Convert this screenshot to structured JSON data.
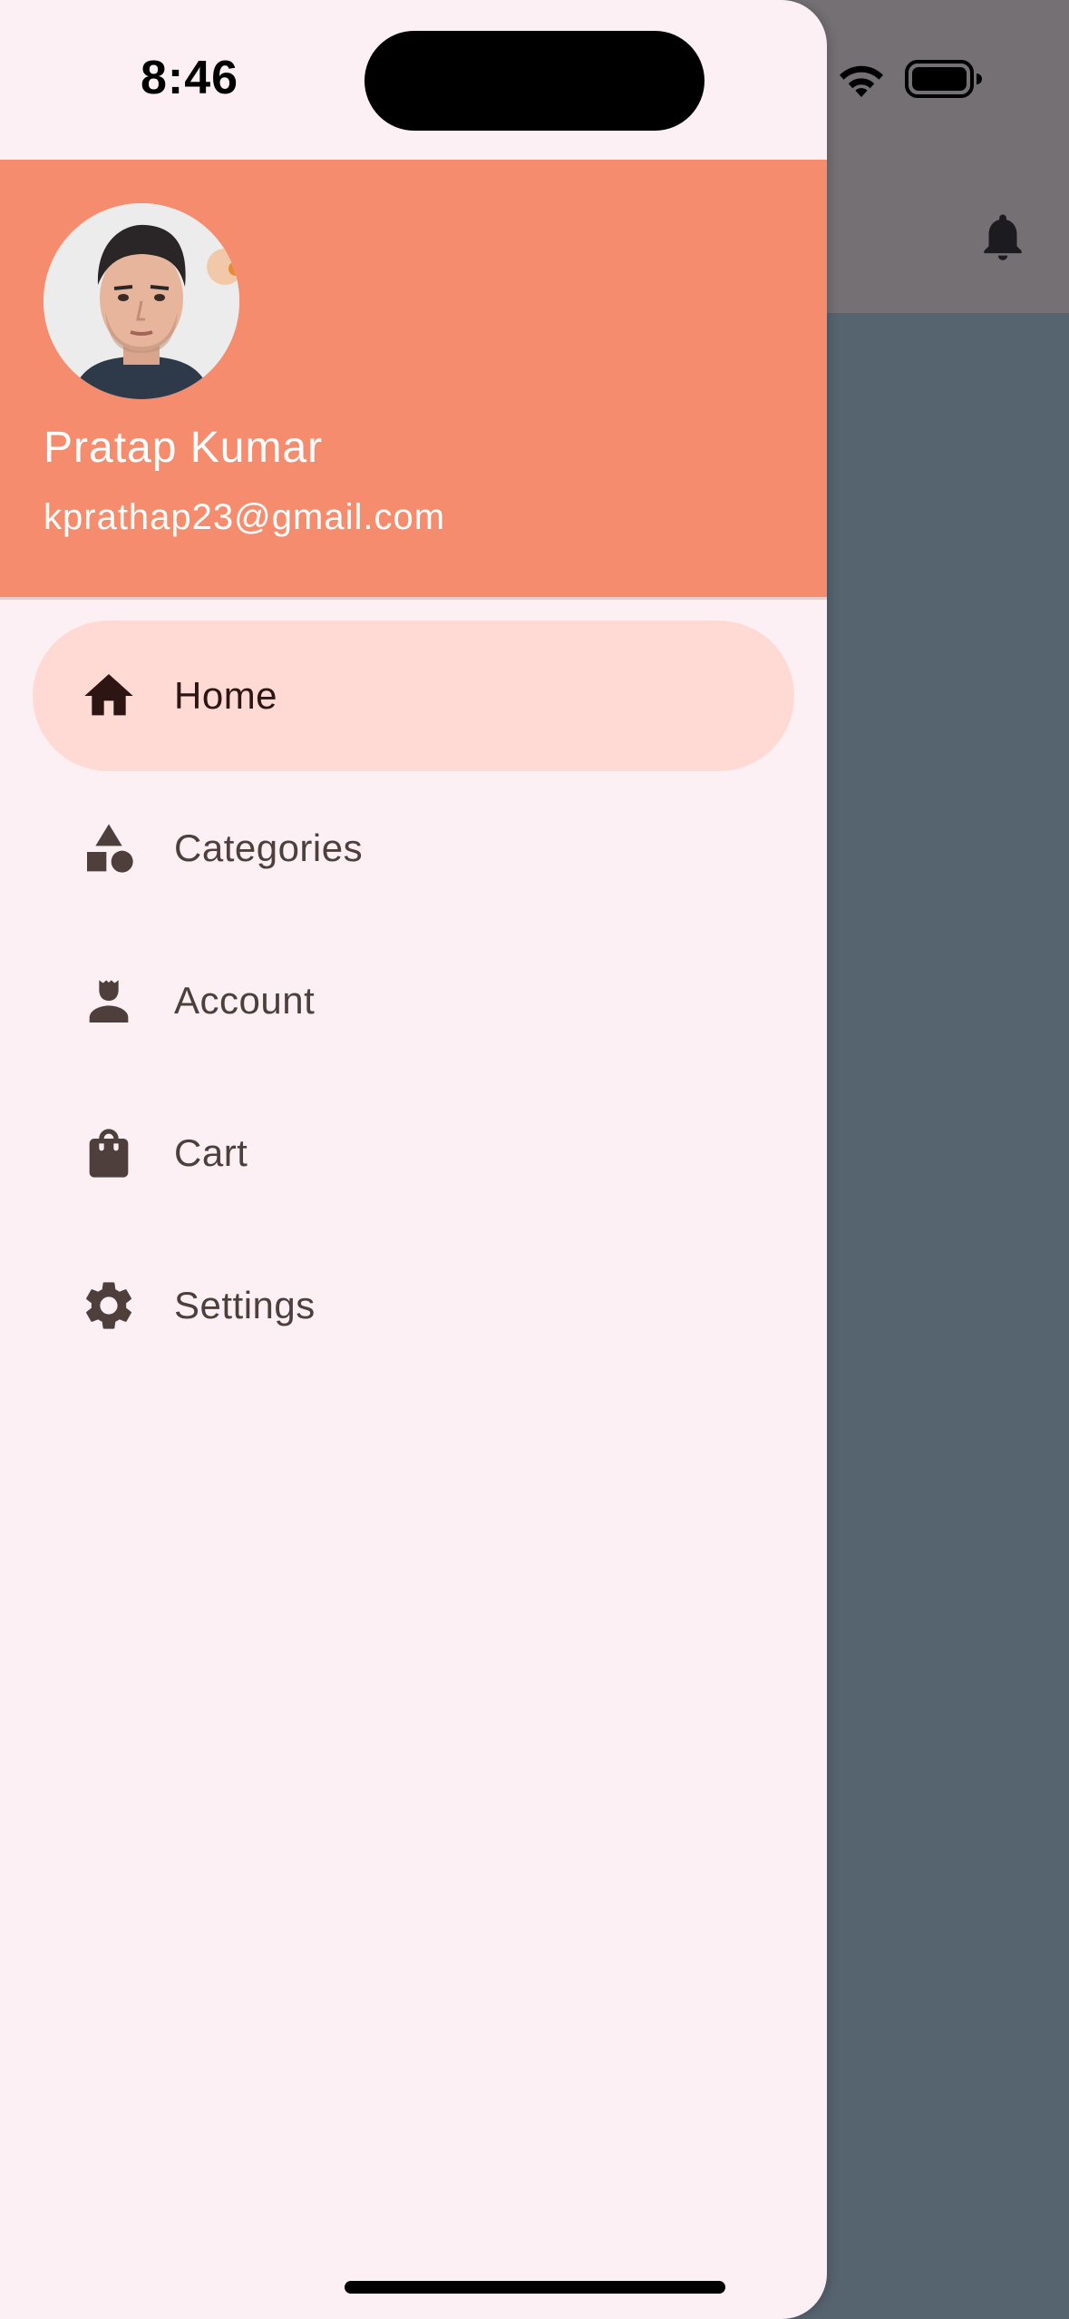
{
  "status_bar": {
    "time": "8:46",
    "icons": [
      "signal-dots-icon",
      "wifi-icon",
      "battery-icon"
    ]
  },
  "background_app": {
    "appbar_color": "#747074",
    "body_color": "#56646f",
    "notification_icon": "bell-icon"
  },
  "drawer": {
    "header": {
      "background_color": "#f58c6d",
      "avatar": "avatar",
      "name": "Pratap Kumar",
      "email": "kprathap23@gmail.com"
    },
    "items": [
      {
        "label": "Home",
        "icon": "home-icon",
        "selected": true
      },
      {
        "label": "Categories",
        "icon": "categories-icon",
        "selected": false
      },
      {
        "label": "Account",
        "icon": "account-icon",
        "selected": false
      },
      {
        "label": "Cart",
        "icon": "shopping-bag-icon",
        "selected": false
      },
      {
        "label": "Settings",
        "icon": "gear-icon",
        "selected": false
      }
    ],
    "selected_color": "#ffdad4",
    "background_color": "#fcf0f4"
  }
}
